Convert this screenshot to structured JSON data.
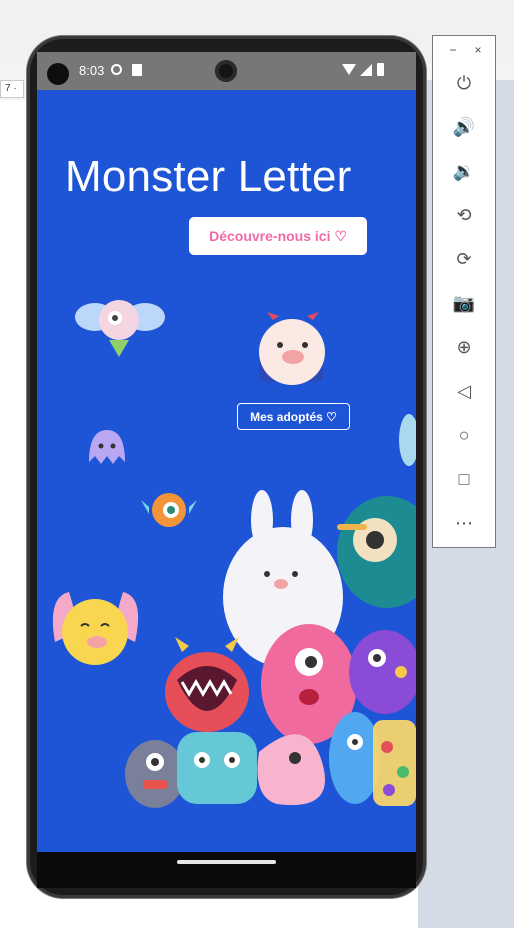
{
  "host": {
    "tab_label": "7 ·"
  },
  "status_bar": {
    "time": "8:03"
  },
  "app": {
    "title": "Monster Letter",
    "discover_button": "Découvre-nous ici ♡",
    "adopted_button": "Mes adoptés ♡"
  },
  "toolbar": {
    "minimize": "−",
    "close": "×",
    "buttons": [
      {
        "name": "power-icon",
        "glyph": "⏻"
      },
      {
        "name": "volume-up-icon",
        "glyph": "🔊"
      },
      {
        "name": "volume-down-icon",
        "glyph": "🔉"
      },
      {
        "name": "rotate-left-icon",
        "glyph": "⟲"
      },
      {
        "name": "rotate-right-icon",
        "glyph": "⟳"
      },
      {
        "name": "camera-icon",
        "glyph": "📷"
      },
      {
        "name": "zoom-icon",
        "glyph": "⊕"
      },
      {
        "name": "back-icon",
        "glyph": "◁"
      },
      {
        "name": "home-icon",
        "glyph": "○"
      },
      {
        "name": "overview-icon",
        "glyph": "□"
      },
      {
        "name": "more-icon",
        "glyph": "⋯"
      }
    ]
  },
  "colors": {
    "app_background": "#1d55d6",
    "button_text_pink": "#f06aa8",
    "status_bar": "#777777"
  }
}
